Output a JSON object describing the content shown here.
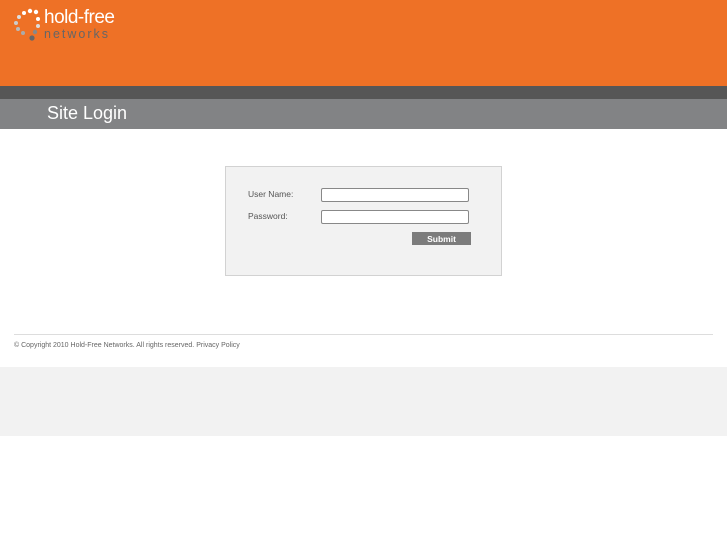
{
  "header": {
    "logo_line1": "hold-free",
    "logo_line2": "networks",
    "title": "Site Login"
  },
  "login": {
    "username_label": "User Name:",
    "username_value": "",
    "password_label": "Password:",
    "password_value": "",
    "submit_label": "Submit"
  },
  "footer": {
    "copyright": "© Copyright 2010 Hold-Free Networks. All rights reserved.",
    "privacy_link": "Privacy Policy"
  }
}
